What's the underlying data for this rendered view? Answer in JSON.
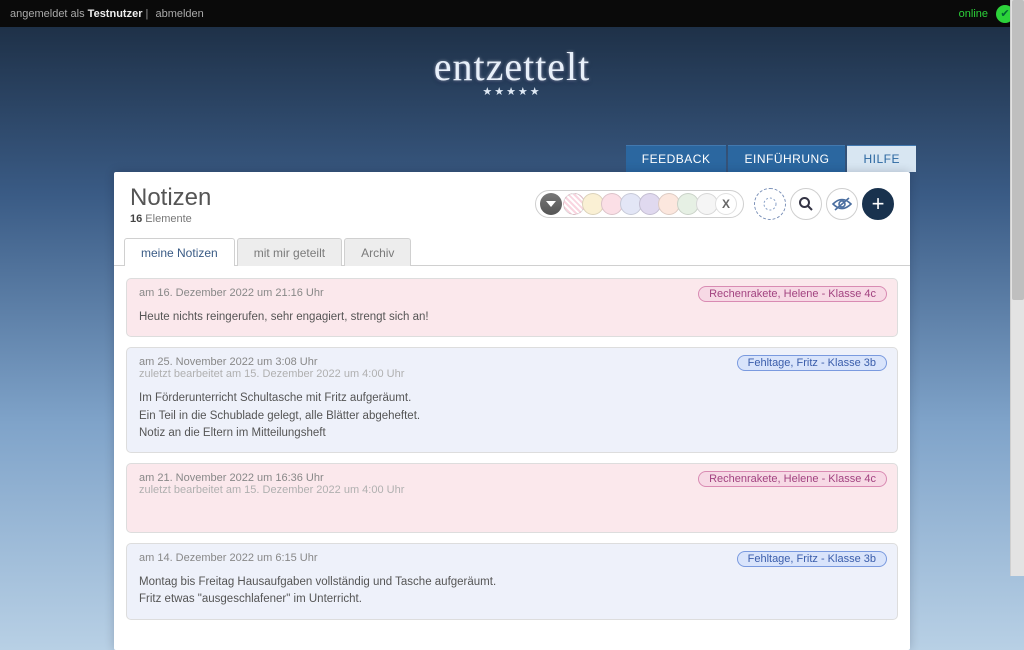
{
  "topbar": {
    "logged_in_prefix": "angemeldet als ",
    "username": "Testnutzer",
    "separator": " | ",
    "logout": "abmelden",
    "online": "online"
  },
  "logo": {
    "text": "entzettelt",
    "stars": "★★★★★"
  },
  "nav": {
    "feedback": "FEEDBACK",
    "intro": "EINFÜHRUNG",
    "help": "HILFE"
  },
  "page": {
    "title": "Notizen",
    "count": "16",
    "count_label": " Elemente"
  },
  "toolbar": {
    "x_label": "X"
  },
  "tabs": {
    "mine": "meine Notizen",
    "shared": "mit mir geteilt",
    "archive": "Archiv"
  },
  "notes": [
    {
      "color": "pink",
      "time": "am 16. Dezember 2022 um 21:16 Uhr",
      "edited": "",
      "body": "Heute nichts reingerufen, sehr engagiert, strengt sich an!",
      "badge": {
        "text": "Rechenrakete, Helene - Klasse 4c",
        "style": "pink"
      }
    },
    {
      "color": "blue",
      "time": "am 25. November 2022 um 3:08 Uhr",
      "edited": "zuletzt bearbeitet am 15. Dezember 2022 um 4:00 Uhr",
      "body": "Im Förderunterricht Schultasche mit Fritz aufgeräumt.\nEin Teil in die Schublade gelegt, alle Blätter abgeheftet.\nNotiz an die Eltern im Mitteilungsheft",
      "badge": {
        "text": "Fehltage, Fritz - Klasse 3b",
        "style": "blue"
      }
    },
    {
      "color": "pink",
      "time": "am 21. November 2022 um 16:36 Uhr",
      "edited": "zuletzt bearbeitet am 15. Dezember 2022 um 4:00 Uhr",
      "body": "",
      "badge": {
        "text": "Rechenrakete, Helene - Klasse 4c",
        "style": "pink"
      }
    },
    {
      "color": "blue",
      "time": "am 14. Dezember 2022 um 6:15 Uhr",
      "edited": "",
      "body": "Montag bis Freitag Hausaufgaben vollständig und Tasche aufgeräumt.\nFritz etwas \"ausgeschlafener\" im Unterricht.",
      "badge": {
        "text": "Fehltage, Fritz - Klasse 3b",
        "style": "blue"
      }
    }
  ]
}
